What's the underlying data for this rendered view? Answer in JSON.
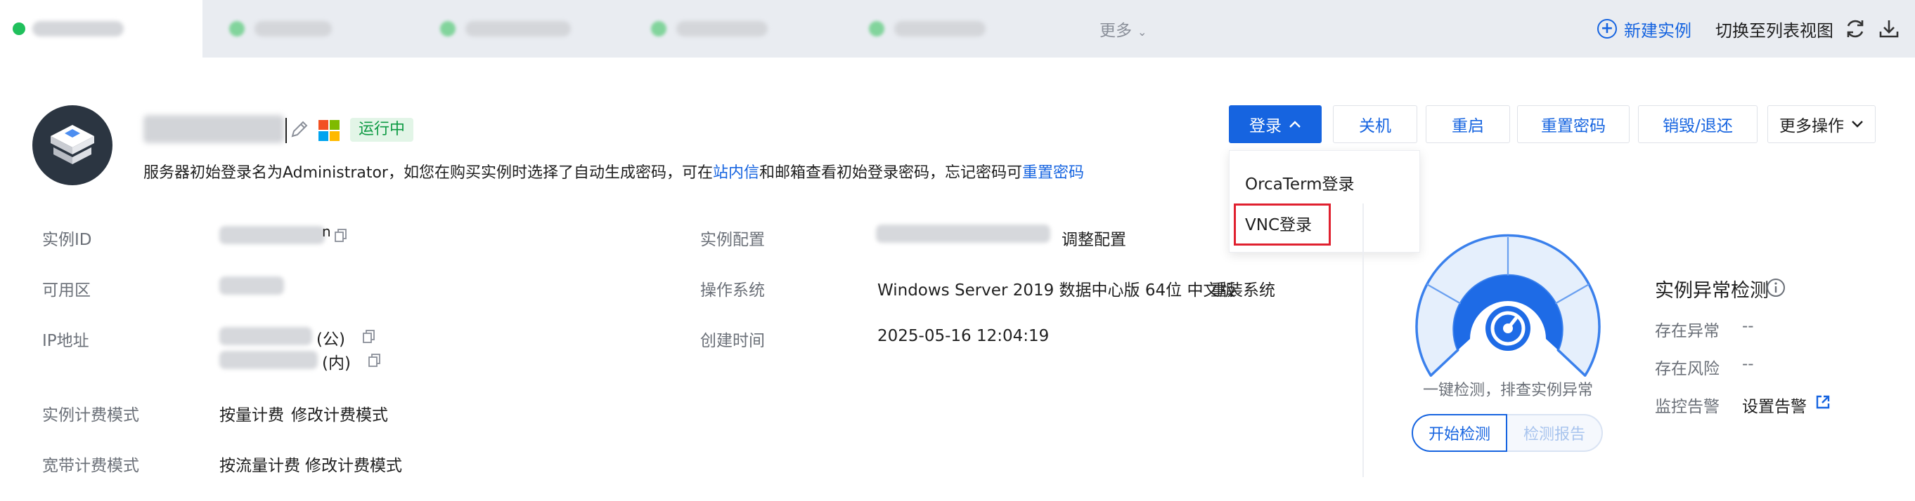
{
  "tabs": {
    "more_label": "更多",
    "new_instance_label": "新建实例",
    "switch_view_label": "切换至列表视图"
  },
  "instance": {
    "status": "运行中",
    "notice_pre": "服务器初始登录名为Administrator，如您在购买实例时选择了自动生成密码，可在",
    "notice_link1": "站内信",
    "notice_mid": "和邮箱查看初始登录密码，忘记密码可",
    "notice_link2": "重置密码"
  },
  "actions": {
    "login": "登录",
    "shutdown": "关机",
    "restart": "重启",
    "reset_password": "重置密码",
    "destroy": "销毁/退还",
    "more_ops": "更多操作"
  },
  "login_menu": {
    "items": [
      "OrcaTerm登录",
      "VNC登录"
    ]
  },
  "details": {
    "instance_id_label": "实例ID",
    "zone_label": "可用区",
    "ip_label": "IP地址",
    "ip_public_suffix": "(公)",
    "ip_private_suffix": "(内)",
    "billing_label": "实例计费模式",
    "billing_value": "按量计费",
    "billing_link": "修改计费模式",
    "bandwidth_label": "宽带计费模式",
    "bandwidth_value": "按流量计费",
    "bandwidth_link": "修改计费模式",
    "config_label": "实例配置",
    "config_link": "调整配置",
    "os_label": "操作系统",
    "os_value": "Windows Server 2019 数据中心版 64位 中文版",
    "os_link": "重装系统",
    "created_label": "创建时间",
    "created_value": "2025-05-16 12:04:19"
  },
  "health": {
    "caption": "一键检测，排查实例异常",
    "start_button": "开始检测",
    "report_button": "检测报告"
  },
  "anomaly": {
    "title": "实例异常检测",
    "exception_label": "存在异常",
    "exception_value": "--",
    "risk_label": "存在风险",
    "risk_value": "--",
    "alarm_label": "监控告警",
    "alarm_link": "设置告警"
  },
  "colors": {
    "accent": "#1664e0",
    "running_green": "#0d9a43",
    "highlight_red": "#e0202f"
  },
  "icons": [
    "plus-circle-icon",
    "refresh-icon",
    "download-icon",
    "edit-pencil-icon",
    "windows-logo-icon",
    "chevron-down-icon",
    "chevron-up-icon",
    "copy-icon",
    "info-icon",
    "external-link-icon",
    "gauge-icon"
  ]
}
